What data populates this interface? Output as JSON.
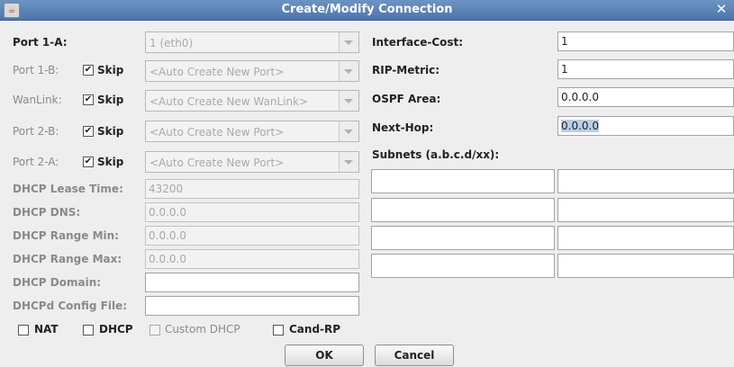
{
  "window": {
    "title": "Create/Modify Connection",
    "close_glyph": "✕",
    "app_icon": "java-icon"
  },
  "left": {
    "port1a": {
      "label": "Port 1-A:",
      "value": "1 (eth0)"
    },
    "port1b": {
      "label": "Port 1-B:",
      "skip": "Skip",
      "value": "<Auto Create New Port>"
    },
    "wanlink": {
      "label": "WanLink:",
      "skip": "Skip",
      "value": "<Auto Create New WanLink>"
    },
    "port2b": {
      "label": "Port 2-B:",
      "skip": "Skip",
      "value": "<Auto Create New Port>"
    },
    "port2a": {
      "label": "Port 2-A:",
      "skip": "Skip",
      "value": "<Auto Create New Port>"
    },
    "dhcp_lease": {
      "label": "DHCP Lease Time:",
      "value": "43200"
    },
    "dhcp_dns": {
      "label": "DHCP DNS:",
      "value": "0.0.0.0"
    },
    "dhcp_range_min": {
      "label": "DHCP Range Min:",
      "value": "0.0.0.0"
    },
    "dhcp_range_max": {
      "label": "DHCP Range Max:",
      "value": "0.0.0.0"
    },
    "dhcp_domain": {
      "label": "DHCP Domain:",
      "value": ""
    },
    "dhcpd_config": {
      "label": "DHCPd Config File:",
      "value": ""
    }
  },
  "checks": {
    "nat": "NAT",
    "dhcp": "DHCP",
    "custom_dhcp": "Custom DHCP",
    "cand_rp": "Cand-RP"
  },
  "right": {
    "interface_cost": {
      "label": "Interface-Cost:",
      "value": "1"
    },
    "rip_metric": {
      "label": "RIP-Metric:",
      "value": "1"
    },
    "ospf_area": {
      "label": "OSPF Area:",
      "value": "0.0.0.0"
    },
    "next_hop": {
      "label": "Next-Hop:",
      "value": "0.0.0.0"
    },
    "subnets_label": "Subnets (a.b.c.d/xx):"
  },
  "buttons": {
    "ok": "OK",
    "cancel": "Cancel"
  }
}
